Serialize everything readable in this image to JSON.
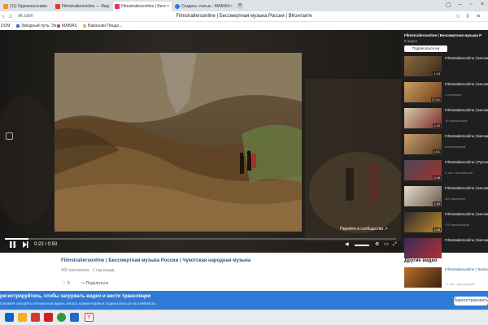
{
  "browser": {
    "tabs": [
      {
        "label": "(11) Одноклассники"
      },
      {
        "label": "Filmstrailersonline — Янд"
      },
      {
        "label": "Filmstrailersonline | Бесс"
      },
      {
        "label": "Создать статью - MABIAS"
      }
    ],
    "new_tab": "+",
    "address": "vk.com",
    "page_title": "Filmstrailersonline | Бессмертная музыка России | ВКонтакте",
    "bookmarks": [
      {
        "label": "DUM"
      },
      {
        "label": "Звёздный путь: Эн..."
      },
      {
        "label": "MABIAS"
      },
      {
        "label": "Вакансии Пицце..."
      }
    ]
  },
  "player": {
    "time": "0:22 / 0:50",
    "progress": 0.06,
    "community_link": "Перейти в сообщество ↗"
  },
  "video": {
    "title": "Filmstrailersonline | Бессмертная музыка России | Чукотская народная музыка",
    "meta": "402 просмотра · 1 год назад",
    "likes": "5",
    "share": "Поделиться"
  },
  "playlist": {
    "title": "Filmstrailersonline | Бессмертная музыка Р",
    "count": "8 видео",
    "subscribe": "Подписаться на плейлист",
    "items": [
      {
        "title": "Filmstrailersonline | Бессмертная музыка",
        "meta": "",
        "duration": "1:03"
      },
      {
        "title": "Filmstrailersonline | Бессмертная музыка",
        "meta": "1 просмотр",
        "duration": "27:01"
      },
      {
        "title": "Filmstrailersonline | Бессмертная музыка",
        "meta": "10 просмотров",
        "duration": "1:32"
      },
      {
        "title": "Filmstrailersonline | Бессмертная музыка",
        "meta": "8 просмотров",
        "duration": "1:01"
      },
      {
        "title": "Filmstrailersonline | Русская драма прот...",
        "meta": "4 тыс. просмотров",
        "duration": "3:08"
      },
      {
        "title": "Filmstrailersonline | Бессмертная музыка",
        "meta": "401 просмотр",
        "duration": "1:26"
      },
      {
        "title": "Filmstrailersonline | Бессмертная музыка",
        "meta": "375 просмотров",
        "duration": "1:08"
      },
      {
        "title": "Filmstrailersonline | Бессмертная музыка",
        "meta": "",
        "duration": ""
      }
    ]
  },
  "other_videos": {
    "heading": "Другие видео",
    "item": {
      "title": "Filmstrailersonline | Трейлеры и фильмы",
      "meta": "17 тыс. просмотров"
    }
  },
  "banner": {
    "line1": "регистрируйтесь, чтобы загружать видео и вести трансляции",
    "line2": "Сможете смотреть интересные видео, писать комментарии и подписываться на плейлисты",
    "button": "Зарегистрироваться"
  },
  "colors": {
    "vk_blue": "#2f7ad6",
    "link": "#2a5885"
  }
}
